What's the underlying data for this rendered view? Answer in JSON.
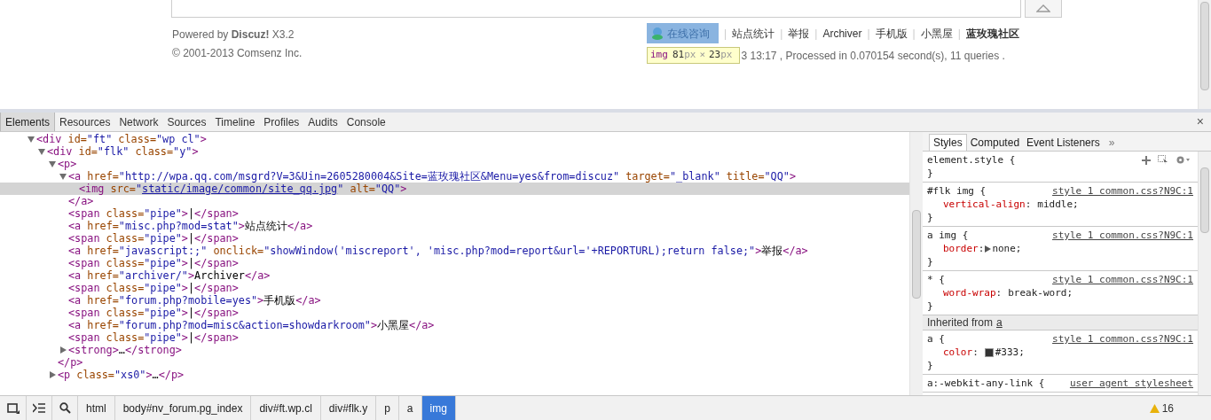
{
  "page": {
    "powered_by": "Powered by **Discuz!** X3.2",
    "copyright": "© 2001-2013 Comsenz Inc.",
    "qq_button": {
      "label": "在线咨询",
      "highlighted": true
    },
    "footer_links": [
      {
        "label": "站点统计",
        "bold": false
      },
      {
        "label": "举报",
        "bold": false
      },
      {
        "label": "Archiver",
        "bold": false
      },
      {
        "label": "手机版",
        "bold": false
      },
      {
        "label": "小黑屋",
        "bold": false
      },
      {
        "label": "蓝玫瑰社区",
        "bold": true
      }
    ],
    "separator": "|",
    "stats": "3 13:17 , Processed in 0.070154 second(s), 11 queries .",
    "size_tooltip": [
      {
        "kind": "tag",
        "text": "img"
      },
      {
        "kind": "num",
        "text": "81"
      },
      {
        "kind": "unit",
        "text": "px"
      },
      {
        "kind": "unit",
        "text": "×"
      },
      {
        "kind": "num",
        "text": "23"
      },
      {
        "kind": "unit",
        "text": "px"
      }
    ]
  },
  "devtools": {
    "tabs": [
      {
        "label": "Elements",
        "selected": true
      },
      {
        "label": "Resources",
        "selected": false
      },
      {
        "label": "Network",
        "selected": false
      },
      {
        "label": "Sources",
        "selected": false
      },
      {
        "label": "Timeline",
        "selected": false
      },
      {
        "label": "Profiles",
        "selected": false
      },
      {
        "label": "Audits",
        "selected": false
      },
      {
        "label": "Console",
        "selected": false
      }
    ],
    "close": "×",
    "tree": [
      {
        "expanded": true,
        "selected": false,
        "parts": [
          {
            "kind": "tag",
            "text": "<div"
          },
          {
            "kind": "attr",
            "text": " id="
          },
          {
            "kind": "value",
            "text": "\"ft\""
          },
          {
            "kind": "attr",
            "text": " class="
          },
          {
            "kind": "value",
            "text": "\"wp cl\""
          },
          {
            "kind": "tag",
            "text": ">"
          }
        ],
        "children": [
          {
            "expanded": true,
            "selected": false,
            "parts": [
              {
                "kind": "tag",
                "text": "<div"
              },
              {
                "kind": "attr",
                "text": " id="
              },
              {
                "kind": "value",
                "text": "\"flk\""
              },
              {
                "kind": "attr",
                "text": " class="
              },
              {
                "kind": "value",
                "text": "\"y\""
              },
              {
                "kind": "tag",
                "text": ">"
              }
            ],
            "children": [
              {
                "expanded": true,
                "selected": false,
                "parts": [
                  {
                    "kind": "tag",
                    "text": "<p>"
                  }
                ],
                "close": [
                  {
                    "kind": "tag",
                    "text": "</p>"
                  }
                ],
                "children": [
                  {
                    "expanded": true,
                    "selected": false,
                    "parts": [
                      {
                        "kind": "tag",
                        "text": "<a"
                      },
                      {
                        "kind": "attr",
                        "text": " href="
                      },
                      {
                        "kind": "value",
                        "text": "\"http://wpa.qq.com/msgrd?V=3&Uin=2605280004&Site=蓝玫瑰社区&Menu=yes&from=discuz\""
                      },
                      {
                        "kind": "attr",
                        "text": " target="
                      },
                      {
                        "kind": "value",
                        "text": "\"_blank\""
                      },
                      {
                        "kind": "attr",
                        "text": " title="
                      },
                      {
                        "kind": "value",
                        "text": "\"QQ\""
                      },
                      {
                        "kind": "tag",
                        "text": ">"
                      }
                    ],
                    "close": [
                      {
                        "kind": "tag",
                        "text": "</a>"
                      }
                    ],
                    "children": [
                      {
                        "selected": true,
                        "parts": [
                          {
                            "kind": "tag",
                            "text": "<img"
                          },
                          {
                            "kind": "attr",
                            "text": " src="
                          },
                          {
                            "kind": "value",
                            "text": "\""
                          },
                          {
                            "kind": "link",
                            "text": "static/image/common/site_qq.jpg"
                          },
                          {
                            "kind": "value",
                            "text": "\""
                          },
                          {
                            "kind": "attr",
                            "text": " alt="
                          },
                          {
                            "kind": "value",
                            "text": "\"QQ\""
                          },
                          {
                            "kind": "tag",
                            "text": ">"
                          }
                        ]
                      }
                    ]
                  },
                  {
                    "selected": false,
                    "parts": [
                      {
                        "kind": "tag",
                        "text": "<span"
                      },
                      {
                        "kind": "attr",
                        "text": " class="
                      },
                      {
                        "kind": "value",
                        "text": "\"pipe\""
                      },
                      {
                        "kind": "tag",
                        "text": ">"
                      },
                      {
                        "kind": "text",
                        "text": "|"
                      },
                      {
                        "kind": "tag",
                        "text": "</span>"
                      }
                    ]
                  },
                  {
                    "selected": false,
                    "parts": [
                      {
                        "kind": "tag",
                        "text": "<a"
                      },
                      {
                        "kind": "attr",
                        "text": " href="
                      },
                      {
                        "kind": "value",
                        "text": "\"misc.php?mod=stat\""
                      },
                      {
                        "kind": "tag",
                        "text": ">"
                      },
                      {
                        "kind": "text",
                        "text": "站点统计"
                      },
                      {
                        "kind": "tag",
                        "text": "</a>"
                      }
                    ]
                  },
                  {
                    "selected": false,
                    "parts": [
                      {
                        "kind": "tag",
                        "text": "<span"
                      },
                      {
                        "kind": "attr",
                        "text": " class="
                      },
                      {
                        "kind": "value",
                        "text": "\"pipe\""
                      },
                      {
                        "kind": "tag",
                        "text": ">"
                      },
                      {
                        "kind": "text",
                        "text": "|"
                      },
                      {
                        "kind": "tag",
                        "text": "</span>"
                      }
                    ]
                  },
                  {
                    "selected": false,
                    "parts": [
                      {
                        "kind": "tag",
                        "text": "<a"
                      },
                      {
                        "kind": "attr",
                        "text": " href="
                      },
                      {
                        "kind": "value",
                        "text": "\"javascript:;\""
                      },
                      {
                        "kind": "attr",
                        "text": " onclick="
                      },
                      {
                        "kind": "value",
                        "text": "\"showWindow('miscreport', 'misc.php?mod=report&url='+REPORTURL);return false;\""
                      },
                      {
                        "kind": "tag",
                        "text": ">"
                      },
                      {
                        "kind": "text",
                        "text": "举报"
                      },
                      {
                        "kind": "tag",
                        "text": "</a>"
                      }
                    ]
                  },
                  {
                    "selected": false,
                    "parts": [
                      {
                        "kind": "tag",
                        "text": "<span"
                      },
                      {
                        "kind": "attr",
                        "text": " class="
                      },
                      {
                        "kind": "value",
                        "text": "\"pipe\""
                      },
                      {
                        "kind": "tag",
                        "text": ">"
                      },
                      {
                        "kind": "text",
                        "text": "|"
                      },
                      {
                        "kind": "tag",
                        "text": "</span>"
                      }
                    ]
                  },
                  {
                    "selected": false,
                    "parts": [
                      {
                        "kind": "tag",
                        "text": "<a"
                      },
                      {
                        "kind": "attr",
                        "text": " href="
                      },
                      {
                        "kind": "value",
                        "text": "\"archiver/\""
                      },
                      {
                        "kind": "tag",
                        "text": ">"
                      },
                      {
                        "kind": "text",
                        "text": "Archiver"
                      },
                      {
                        "kind": "tag",
                        "text": "</a>"
                      }
                    ]
                  },
                  {
                    "selected": false,
                    "parts": [
                      {
                        "kind": "tag",
                        "text": "<span"
                      },
                      {
                        "kind": "attr",
                        "text": " class="
                      },
                      {
                        "kind": "value",
                        "text": "\"pipe\""
                      },
                      {
                        "kind": "tag",
                        "text": ">"
                      },
                      {
                        "kind": "text",
                        "text": "|"
                      },
                      {
                        "kind": "tag",
                        "text": "</span>"
                      }
                    ]
                  },
                  {
                    "selected": false,
                    "parts": [
                      {
                        "kind": "tag",
                        "text": "<a"
                      },
                      {
                        "kind": "attr",
                        "text": " href="
                      },
                      {
                        "kind": "value",
                        "text": "\"forum.php?mobile=yes\""
                      },
                      {
                        "kind": "tag",
                        "text": ">"
                      },
                      {
                        "kind": "text",
                        "text": "手机版"
                      },
                      {
                        "kind": "tag",
                        "text": "</a>"
                      }
                    ]
                  },
                  {
                    "selected": false,
                    "parts": [
                      {
                        "kind": "tag",
                        "text": "<span"
                      },
                      {
                        "kind": "attr",
                        "text": " class="
                      },
                      {
                        "kind": "value",
                        "text": "\"pipe\""
                      },
                      {
                        "kind": "tag",
                        "text": ">"
                      },
                      {
                        "kind": "text",
                        "text": "|"
                      },
                      {
                        "kind": "tag",
                        "text": "</span>"
                      }
                    ]
                  },
                  {
                    "selected": false,
                    "parts": [
                      {
                        "kind": "tag",
                        "text": "<a"
                      },
                      {
                        "kind": "attr",
                        "text": " href="
                      },
                      {
                        "kind": "value",
                        "text": "\"forum.php?mod=misc&action=showdarkroom\""
                      },
                      {
                        "kind": "tag",
                        "text": ">"
                      },
                      {
                        "kind": "text",
                        "text": "小黑屋"
                      },
                      {
                        "kind": "tag",
                        "text": "</a>"
                      }
                    ]
                  },
                  {
                    "selected": false,
                    "parts": [
                      {
                        "kind": "tag",
                        "text": "<span"
                      },
                      {
                        "kind": "attr",
                        "text": " class="
                      },
                      {
                        "kind": "value",
                        "text": "\"pipe\""
                      },
                      {
                        "kind": "tag",
                        "text": ">"
                      },
                      {
                        "kind": "text",
                        "text": "|"
                      },
                      {
                        "kind": "tag",
                        "text": "</span>"
                      }
                    ]
                  },
                  {
                    "expanded": false,
                    "selected": false,
                    "parts": [
                      {
                        "kind": "tag",
                        "text": "<strong>"
                      },
                      {
                        "kind": "text",
                        "text": "…"
                      },
                      {
                        "kind": "tag",
                        "text": "</strong>"
                      }
                    ]
                  }
                ]
              },
              {
                "expanded": false,
                "selected": false,
                "parts": [
                  {
                    "kind": "tag",
                    "text": "<p"
                  },
                  {
                    "kind": "attr",
                    "text": " class="
                  },
                  {
                    "kind": "value",
                    "text": "\"xs0\""
                  },
                  {
                    "kind": "tag",
                    "text": ">"
                  },
                  {
                    "kind": "text",
                    "text": "…"
                  },
                  {
                    "kind": "tag",
                    "text": "</p>"
                  }
                ]
              }
            ]
          }
        ]
      }
    ],
    "side_tabs": [
      {
        "label": "Styles",
        "selected": true
      },
      {
        "label": "Computed",
        "selected": false
      },
      {
        "label": "Event Listeners",
        "selected": false
      }
    ],
    "more": "»",
    "rules": [
      {
        "kind": "rule",
        "selector": "element.style {",
        "close": "}"
      },
      {
        "kind": "rule",
        "selector": "#flk img {",
        "source": "style 1 common.css?N9C:1",
        "declarations": [
          {
            "property": "vertical-align",
            "value": "middle;"
          }
        ],
        "close": "}"
      },
      {
        "kind": "rule",
        "selector": "a img {",
        "source": "style 1 common.css?N9C:1",
        "declarations": [
          {
            "property": "border",
            "value": "none;",
            "expandable": true
          }
        ],
        "close": "}"
      },
      {
        "kind": "rule",
        "selector": "* {",
        "source": "style 1 common.css?N9C:1",
        "declarations": [
          {
            "property": "word-wrap",
            "value": "break-word;"
          }
        ],
        "close": "}"
      },
      {
        "kind": "inherited",
        "label": "Inherited from",
        "link": "a"
      },
      {
        "kind": "rule",
        "selector": "a {",
        "source": "style 1 common.css?N9C:1",
        "declarations": [
          {
            "property": "color",
            "value": "#333;",
            "color": "#333333"
          }
        ],
        "close": "}"
      },
      {
        "kind": "rule",
        "selector": "a:-webkit-any-link {",
        "source": "user agent stylesheet"
      }
    ],
    "colon": ":",
    "breadcrumbs": [
      {
        "label": "html",
        "selected": false
      },
      {
        "label": "body#nv_forum.pg_index",
        "selected": false
      },
      {
        "label": "div#ft.wp.cl",
        "selected": false
      },
      {
        "label": "div#flk.y",
        "selected": false
      },
      {
        "label": "p",
        "selected": false
      },
      {
        "label": "a",
        "selected": false
      },
      {
        "label": "img",
        "selected": true
      }
    ],
    "warnings": "16"
  }
}
